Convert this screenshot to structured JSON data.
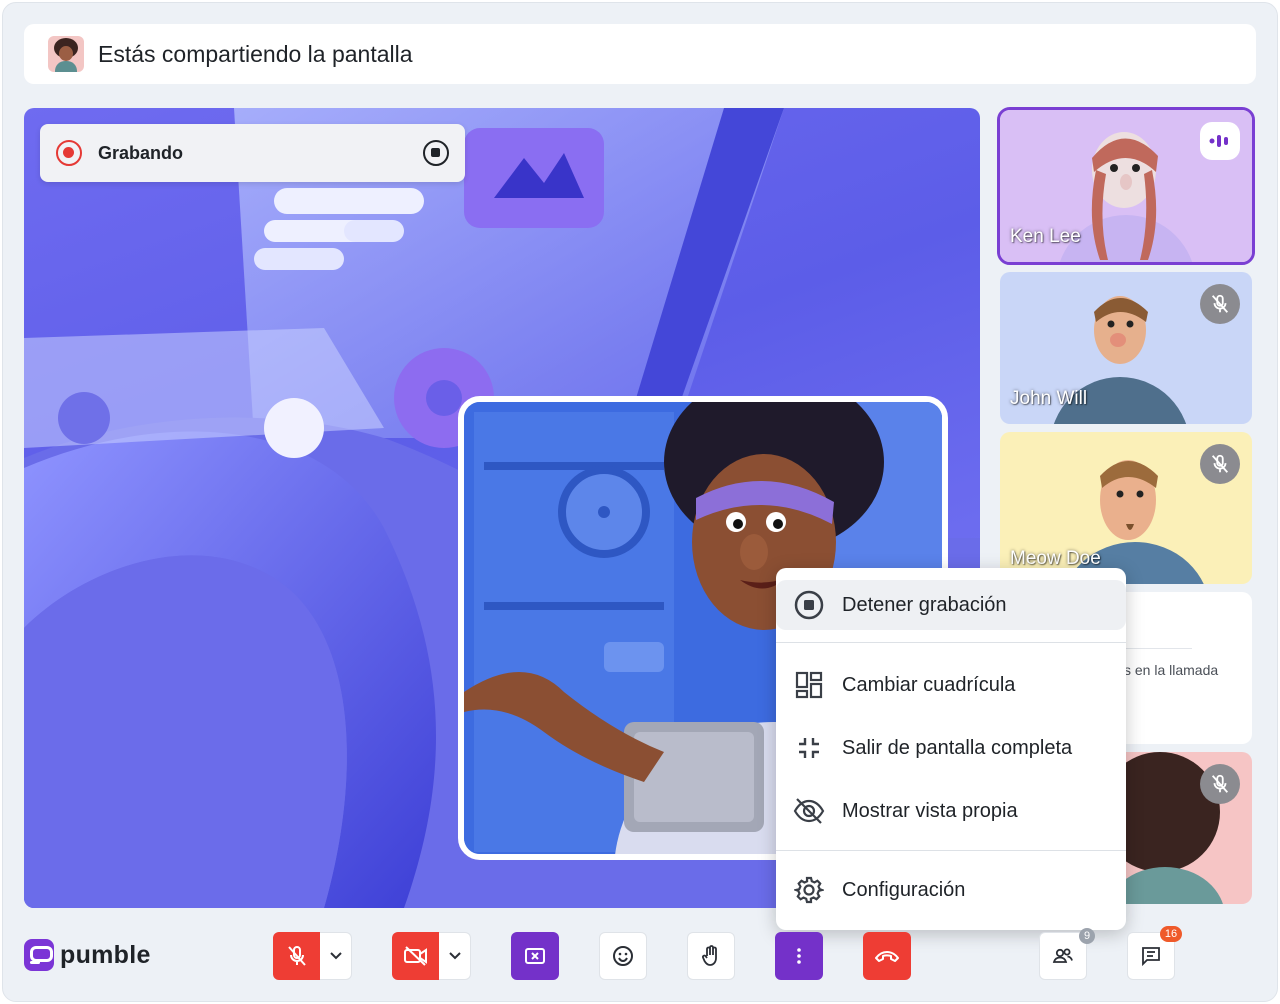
{
  "banner": {
    "title": "Estás compartiendo la pantalla"
  },
  "recording": {
    "label": "Grabando"
  },
  "participants": [
    {
      "name": "Ken Lee",
      "status": "speaking",
      "bg": "#d9bff5"
    },
    {
      "name": "John Will",
      "status": "muted",
      "bg": "#c9d6f7"
    },
    {
      "name": "Meow Doe",
      "status": "muted",
      "bg": "#fbf0b8"
    },
    {
      "name": "",
      "partial_text": "s en la llamada"
    },
    {
      "name": "",
      "status": "muted",
      "bg": "#f6c5c5"
    }
  ],
  "menu": {
    "items": [
      {
        "label": "Detener grabación",
        "icon": "stop-recording-icon"
      },
      {
        "label": "Cambiar cuadrícula",
        "icon": "grid-layout-icon"
      },
      {
        "label": "Salir de pantalla completa",
        "icon": "exit-fullscreen-icon"
      },
      {
        "label": "Mostrar vista propia",
        "icon": "eye-off-icon"
      },
      {
        "label": "Configuración",
        "icon": "gear-icon"
      }
    ]
  },
  "brand": {
    "name": "pumble",
    "color": "#7b35d6"
  },
  "toolbar": {
    "participants_count": "9",
    "chat_count": "16",
    "icons": [
      "mic-off-icon",
      "video-off-icon",
      "stop-share-icon",
      "emoji-icon",
      "raise-hand-icon",
      "more-icon",
      "hang-up-icon",
      "people-icon",
      "chat-icon"
    ]
  },
  "colors": {
    "accent": "#7431c9",
    "danger": "#ee3d34",
    "recording": "#e53935"
  }
}
